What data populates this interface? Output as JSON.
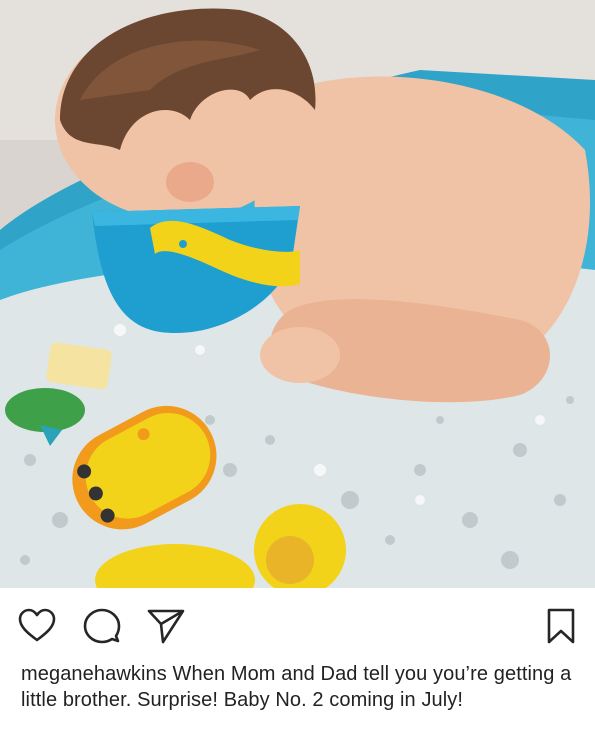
{
  "post": {
    "username": "meganehawkins",
    "caption": "When Mom and Dad tell you you’re getting a little brother.  Surprise! Baby No. 2 coming in July!"
  },
  "actions": {
    "like_icon": "heart-icon",
    "comment_icon": "comment-icon",
    "share_icon": "paper-plane-icon",
    "save_icon": "bookmark-icon"
  },
  "colors": {
    "tub": "#2fa3c8",
    "water": "#dfe6e8",
    "skin": "#f1c3a6",
    "hair": "#6b4630",
    "toy_yellow": "#f3d21a",
    "toy_orange": "#f29a1c",
    "icon_stroke": "#262626"
  }
}
